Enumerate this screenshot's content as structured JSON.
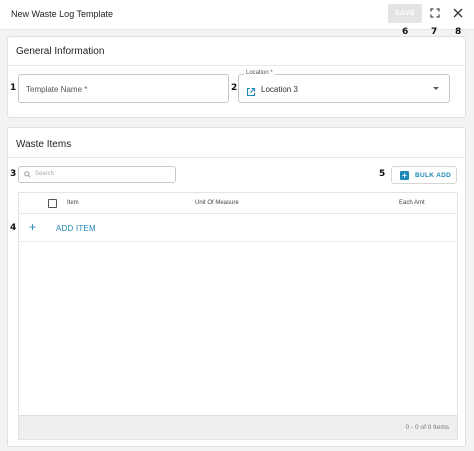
{
  "window": {
    "title": "New Waste Log Template",
    "save_label": "SAVE"
  },
  "callouts": [
    "1",
    "2",
    "3",
    "4",
    "5",
    "6",
    "7",
    "8"
  ],
  "general": {
    "title": "General Information",
    "template_name_placeholder": "Template Name *",
    "location_label": "Location *",
    "location_value": "Location 3"
  },
  "waste_items": {
    "title": "Waste Items",
    "search_placeholder": "Search",
    "bulk_add_label": "BULK ADD",
    "columns": [
      "Item",
      "Unit Of Measure",
      "Each Amt"
    ],
    "add_item_label": "ADD ITEM",
    "pagination": "0 - 0 of 0 Items"
  },
  "colors": {
    "accent": "#1e88b8",
    "disabled_button": "#e4e4e4",
    "background": "#f3f3f3"
  },
  "icons": {
    "fullscreen": "fullscreen-icon",
    "close": "close-icon",
    "location": "open-external-icon",
    "search": "search-icon",
    "plus": "plus-icon"
  }
}
